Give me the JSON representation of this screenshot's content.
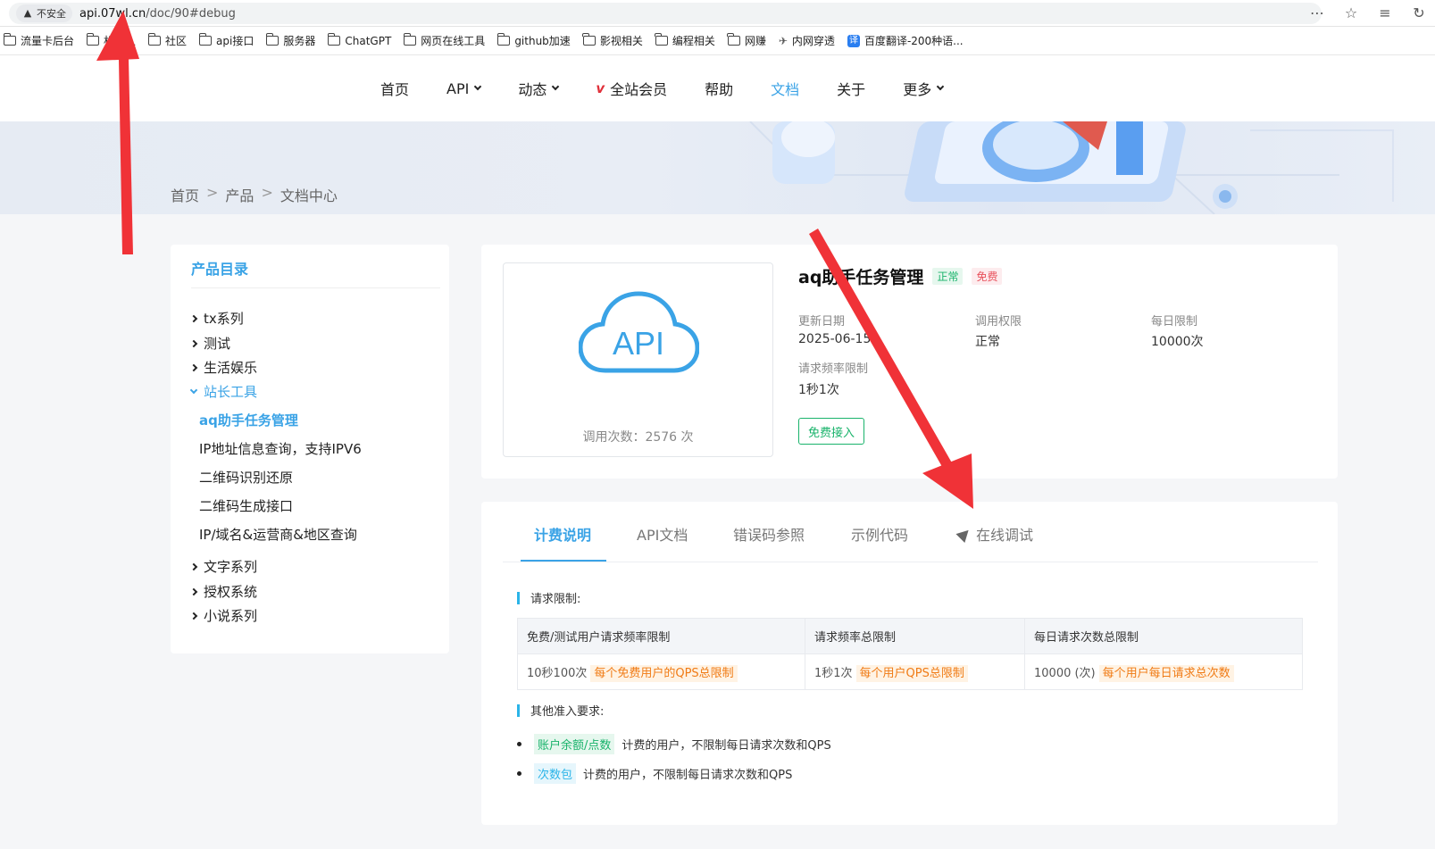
{
  "browser": {
    "security_label": "不安全",
    "url_host": "api.07wl.cn",
    "url_path": "/doc/90#debug",
    "icons": [
      "dots-icon",
      "star-icon",
      "favorites-icon",
      "refresh-icon"
    ]
  },
  "bookmarks": [
    {
      "label": "流量卡后台",
      "type": "folder"
    },
    {
      "label": "机器人",
      "type": "folder"
    },
    {
      "label": "社区",
      "type": "folder"
    },
    {
      "label": "api接口",
      "type": "folder"
    },
    {
      "label": "服务器",
      "type": "folder"
    },
    {
      "label": "ChatGPT",
      "type": "folder"
    },
    {
      "label": "网页在线工具",
      "type": "folder"
    },
    {
      "label": "github加速",
      "type": "folder"
    },
    {
      "label": "影视相关",
      "type": "folder"
    },
    {
      "label": "编程相关",
      "type": "folder"
    },
    {
      "label": "网赚",
      "type": "folder"
    },
    {
      "label": "内网穿透",
      "type": "tool"
    },
    {
      "label": "百度翻译-200种语...",
      "type": "translate"
    }
  ],
  "nav": {
    "items": [
      {
        "label": "首页",
        "has_caret": false
      },
      {
        "label": "API",
        "has_caret": true
      },
      {
        "label": "动态",
        "has_caret": true
      },
      {
        "label": "全站会员",
        "has_caret": false,
        "vip": true
      },
      {
        "label": "帮助",
        "has_caret": false
      },
      {
        "label": "文档",
        "has_caret": false,
        "active": true
      },
      {
        "label": "关于",
        "has_caret": false
      },
      {
        "label": "更多",
        "has_caret": true
      }
    ],
    "vip_mark": "v"
  },
  "breadcrumb": [
    "首页",
    "产品",
    "文档中心"
  ],
  "breadcrumb_sep": ">",
  "sidebar": {
    "title": "产品目录",
    "groups_top": [
      "tx系列",
      "测试",
      "生活娱乐"
    ],
    "open_group": "站长工具",
    "sub_items": [
      "aq助手任务管理",
      "IP地址信息查询，支持IPV6",
      "二维码识别还原",
      "二维码生成接口",
      "IP/域名&运营商&地区查询"
    ],
    "groups_bottom": [
      "文字系列",
      "授权系统",
      "小说系列"
    ]
  },
  "product": {
    "name": "aq助手任务管理",
    "status_badge": "正常",
    "price_badge": "免费",
    "logo_text": "API",
    "call_count": "调用次数：2576 次",
    "meta": {
      "update_label": "更新日期",
      "update_value": "2025-06-15",
      "perm_label": "调用权限",
      "perm_value": "正常",
      "daily_label": "每日限制",
      "daily_value": "10000次",
      "freq_label": "请求频率限制",
      "freq_value": "1秒1次"
    },
    "access_button": "免费接入"
  },
  "tabs": [
    {
      "label": "计费说明",
      "active": true
    },
    {
      "label": "API文档"
    },
    {
      "label": "错误码参照"
    },
    {
      "label": "示例代码"
    },
    {
      "label": "在线调试",
      "icon": "send-icon"
    }
  ],
  "billing": {
    "limit_heading": "请求限制:",
    "table_headers": [
      "免费/测试用户请求频率限制",
      "请求频率总限制",
      "每日请求次数总限制"
    ],
    "table_row": [
      {
        "value": "10秒100次",
        "note": "每个免费用户的QPS总限制"
      },
      {
        "value": "1秒1次",
        "note": "每个用户QPS总限制"
      },
      {
        "value": "10000 (次)",
        "note": "每个用户每日请求总次数"
      }
    ],
    "other_heading": "其他准入要求:",
    "requirements": [
      {
        "tag": "账户余额/点数",
        "text": "计费的用户，不限制每日请求次数和QPS",
        "tag_color": "green"
      },
      {
        "tag": "次数包",
        "text": "计费的用户，不限制每日请求次数和QPS",
        "tag_color": "blue"
      }
    ]
  },
  "colors": {
    "accent": "#3aa3e6",
    "green": "#19b36b",
    "orange": "#f07b15",
    "red_arrow": "#f03237"
  }
}
